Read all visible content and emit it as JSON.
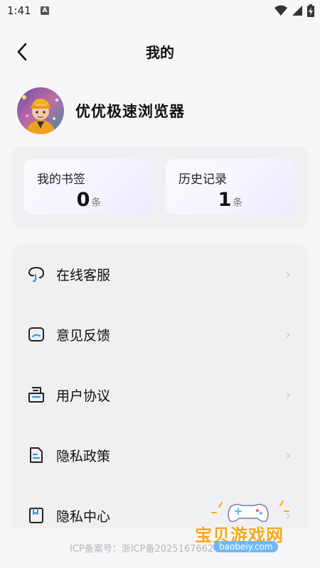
{
  "status": {
    "time": "1:41",
    "badge": "A"
  },
  "header": {
    "title": "我的"
  },
  "profile": {
    "name": "优优极速浏览器"
  },
  "stats": [
    {
      "label": "我的书签",
      "value": "0",
      "unit": "条"
    },
    {
      "label": "历史记录",
      "value": "1",
      "unit": "条"
    }
  ],
  "menu": [
    {
      "label": "在线客服",
      "icon": "customer-service-icon"
    },
    {
      "label": "意见反馈",
      "icon": "feedback-icon"
    },
    {
      "label": "用户协议",
      "icon": "user-agreement-icon"
    },
    {
      "label": "隐私政策",
      "icon": "privacy-policy-icon"
    },
    {
      "label": "隐私中心",
      "icon": "privacy-center-icon"
    }
  ],
  "footer": {
    "icp": "ICP备案号：浙ICP备2025167662"
  },
  "watermark": {
    "title": "宝贝游戏网",
    "url": "baobeiy.com"
  },
  "colors": {
    "accent": "#2f9bd8",
    "background": "#f7f7f9",
    "card": "#f0f0f3",
    "watermark": "#f6a71c"
  }
}
